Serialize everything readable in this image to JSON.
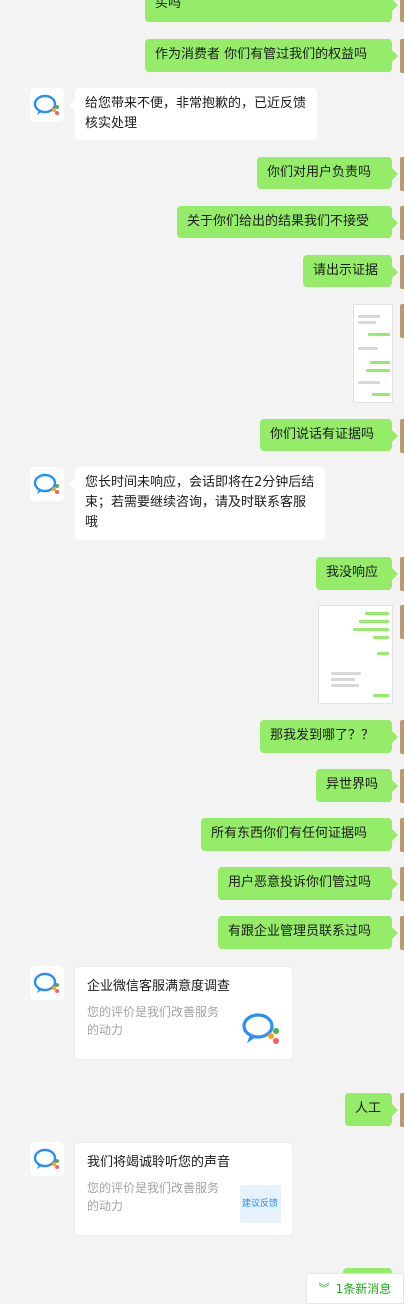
{
  "messages": [
    {
      "from": "me",
      "text": "买吗"
    },
    {
      "from": "me",
      "text": "作为消费者 你们有管过我们的权益吗"
    },
    {
      "from": "service",
      "text": "给您带来不便，非常抱歉的，已近反馈核实处理"
    },
    {
      "from": "me",
      "text": "你们对用户负责吗"
    },
    {
      "from": "me",
      "text": "关于你们给出的结果我们不接受"
    },
    {
      "from": "me",
      "text": "请出示证据"
    },
    {
      "from": "me",
      "type": "image",
      "text": ""
    },
    {
      "from": "me",
      "text": "你们说话有证据吗"
    },
    {
      "from": "service",
      "text": "您长时间未响应，会话即将在2分钟后结束；若需要继续咨询，请及时联系客服哦"
    },
    {
      "from": "me",
      "text": "我没响应"
    },
    {
      "from": "me",
      "type": "image",
      "text": ""
    },
    {
      "from": "me",
      "text": "那我发到哪了？？"
    },
    {
      "from": "me",
      "text": "异世界吗"
    },
    {
      "from": "me",
      "text": "所有东西你们有任何证据吗"
    },
    {
      "from": "me",
      "text": "用户恶意投诉你们管过吗"
    },
    {
      "from": "me",
      "text": "有跟企业管理员联系过吗"
    },
    {
      "from": "me",
      "text": "人工"
    }
  ],
  "cards": [
    {
      "title": "企业微信客服满意度调查",
      "subtitle": "您的评价是我们改善服务的动力",
      "thumb_icon": "wecom-logo-icon"
    },
    {
      "title": "我们将竭诚聆听您的声音",
      "subtitle": "您的评价是我们改善服务的动力",
      "thumb_text": "建议反馈"
    }
  ],
  "new_messages": {
    "icon": "double-chevron-down-icon",
    "label": "1条新消息"
  },
  "colors": {
    "my_bubble": "#95ec69",
    "their_bubble": "#ffffff",
    "background": "#f3f3f3",
    "accent": "#1aad19"
  }
}
